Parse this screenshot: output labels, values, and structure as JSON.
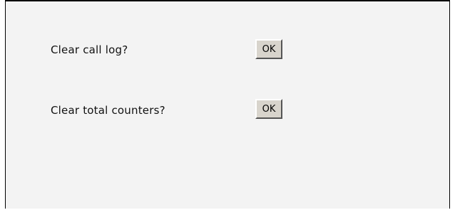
{
  "actions": [
    {
      "label": "Clear call log?",
      "button_label": "OK"
    },
    {
      "label": "Clear total counters?",
      "button_label": "OK"
    }
  ],
  "colors": {
    "panel_background": "#f3f3f3",
    "button_face": "#d8d4cc",
    "border": "#000000"
  }
}
